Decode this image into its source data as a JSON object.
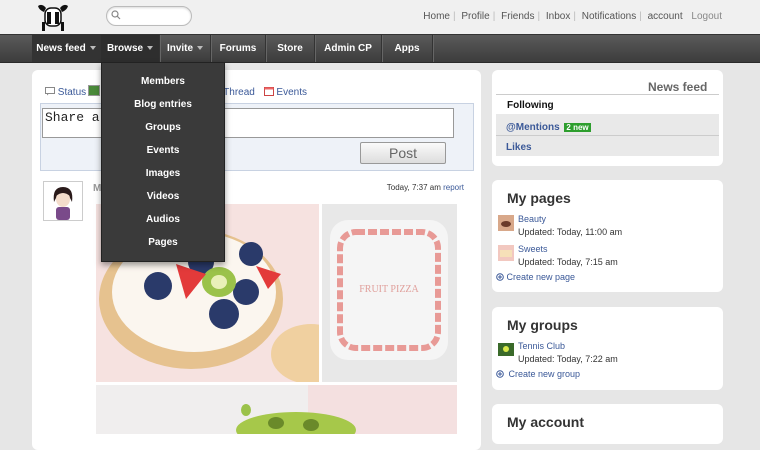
{
  "search": {
    "placeholder": ""
  },
  "toplinks": [
    "Home",
    "Profile",
    "Friends",
    "Inbox",
    "Notifications",
    "account"
  ],
  "logout": "Logout",
  "nav": [
    {
      "label": "News feed",
      "caret": true
    },
    {
      "label": "Browse",
      "caret": true
    },
    {
      "label": "Invite",
      "caret": true
    },
    {
      "label": "Forums",
      "caret": false
    },
    {
      "label": "Store",
      "caret": false
    },
    {
      "label": "Admin CP",
      "caret": false
    },
    {
      "label": "Apps",
      "caret": false
    }
  ],
  "browse_menu": [
    "Members",
    "Blog entries",
    "Groups",
    "Events",
    "Images",
    "Videos",
    "Audios",
    "Pages"
  ],
  "share": {
    "tab_status": "Status",
    "tab_thread": "Thread",
    "tab_events": "Events",
    "text": "Share a",
    "post_label": "Post"
  },
  "feed_item": {
    "author_initial": "M",
    "time": "Today, 7:37 am",
    "report": "report"
  },
  "right": {
    "newsfeed": {
      "title": "News feed",
      "following": "Following",
      "mentions": "@Mentions",
      "mentions_badge": "2 new",
      "likes": "Likes"
    },
    "mypages": {
      "title": "My pages",
      "items": [
        {
          "name": "Beauty",
          "updated": "Updated: Today, 11:00 am"
        },
        {
          "name": "Sweets",
          "updated": "Updated: Today, 7:15 am"
        }
      ],
      "create": "Create new page"
    },
    "mygroups": {
      "title": "My groups",
      "items": [
        {
          "name": "Tennis Club",
          "updated": "Updated: Today, 7:22 am"
        }
      ],
      "create": "Create new group"
    },
    "myaccount": {
      "title": "My account"
    }
  },
  "colors": {
    "link": "#3b5998",
    "badge": "#2e9e2e",
    "nav_bg": "#4a4a4a"
  }
}
